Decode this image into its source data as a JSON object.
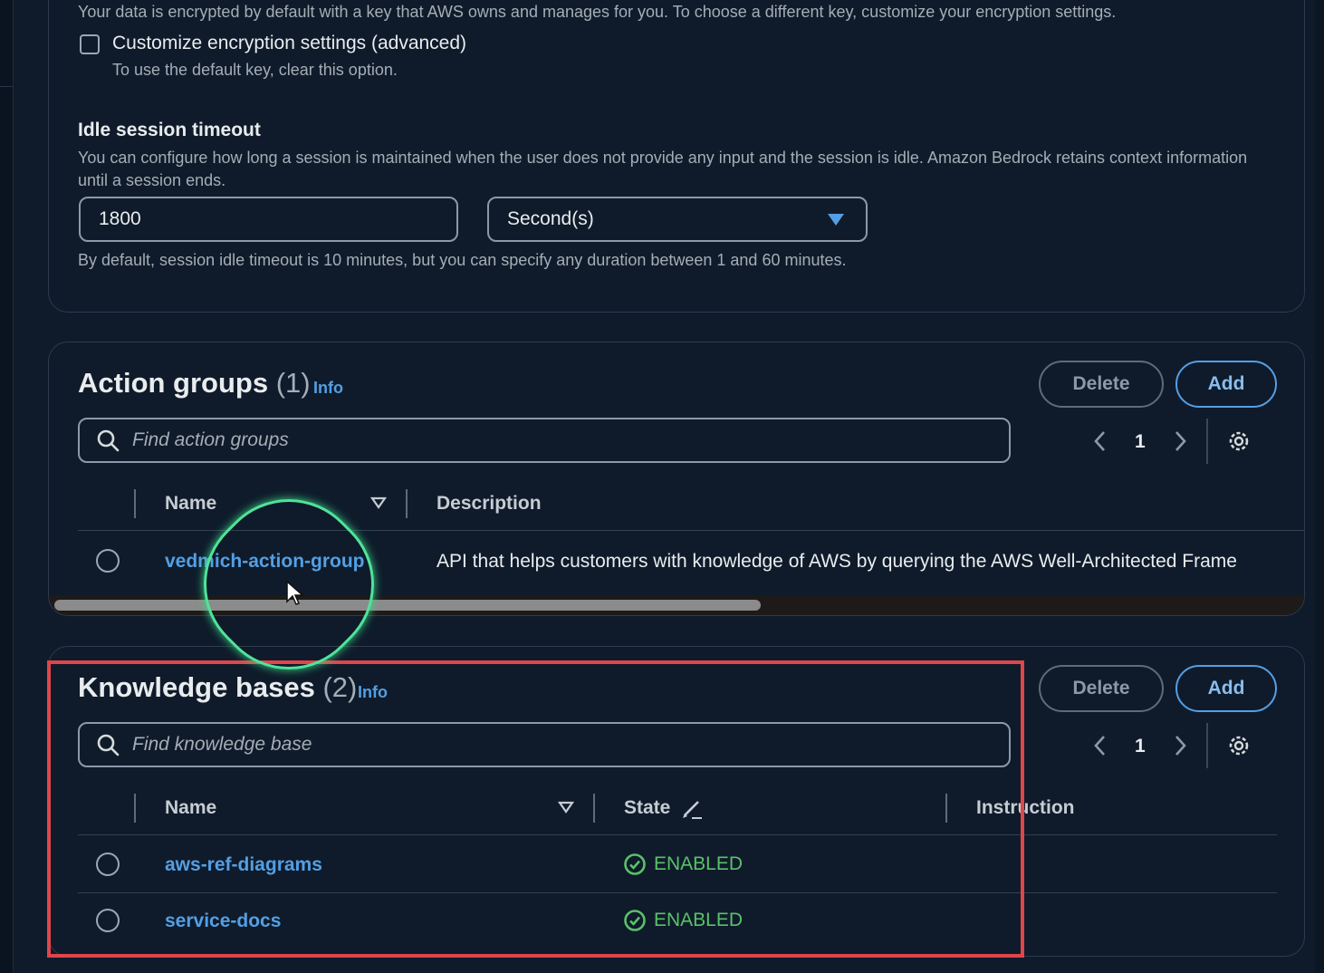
{
  "encryption": {
    "intro_text": "Your data is encrypted by default with a key that AWS owns and manages for you. To choose a different key, customize your encryption settings.",
    "customize_label": "Customize encryption settings (advanced)",
    "customize_hint": "To use the default key, clear this option.",
    "customize_checked": false
  },
  "idle_timeout": {
    "title": "Idle session timeout",
    "description": "You can configure how long a session is maintained when the user does not provide any input and the session is idle. Amazon Bedrock retains context information until a session ends.",
    "value": "1800",
    "unit": "Second(s)",
    "hint": "By default, session idle timeout is 10 minutes, but you can specify any duration between 1 and 60 minutes."
  },
  "action_groups": {
    "title": "Action groups",
    "count": "(1)",
    "info": "Info",
    "delete_label": "Delete",
    "add_label": "Add",
    "search_placeholder": "Find action groups",
    "page": "1",
    "columns": {
      "name": "Name",
      "description": "Description"
    },
    "rows": [
      {
        "name": "vedmich-action-group",
        "description": "API that helps customers with knowledge of AWS by querying the AWS Well-Architected Frame"
      }
    ]
  },
  "knowledge_bases": {
    "title": "Knowledge bases",
    "count": "(2)",
    "info": "Info",
    "delete_label": "Delete",
    "add_label": "Add",
    "search_placeholder": "Find knowledge base",
    "page": "1",
    "columns": {
      "name": "Name",
      "state": "State",
      "instruction": "Instruction"
    },
    "rows": [
      {
        "name": "aws-ref-diagrams",
        "state": "ENABLED"
      },
      {
        "name": "service-docs",
        "state": "ENABLED"
      }
    ]
  },
  "colors": {
    "accent": "#539fe5",
    "success": "#5ac16a",
    "highlight": "#e0454a",
    "cursor_ring": "#51e39a"
  }
}
